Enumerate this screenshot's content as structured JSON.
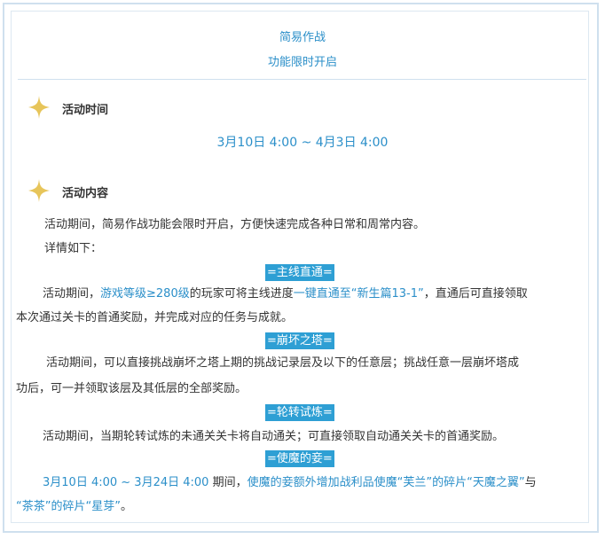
{
  "header": {
    "title": "简易作战",
    "subtitle": "功能限时开启"
  },
  "colors": {
    "accent": "#2b8fc9",
    "tag_bg": "#2e9fd4",
    "star": "#e7c55a",
    "border": "#cfe0ee"
  },
  "section_time": {
    "icon": "star-icon",
    "title": "活动时间",
    "time": "3月10日 4:00 ~ 4月3日 4:00"
  },
  "section_content": {
    "icon": "star-icon",
    "title": "活动内容",
    "intro": "活动期间，简易作战功能会限时开启，方便快速完成各种日常和周常内容。",
    "detail": "详情如下："
  },
  "mainline": {
    "tag": "=主线直通=",
    "p_a": "活动期间，",
    "p_b": "游戏等级≥280级",
    "p_c": "的玩家可将主线进度",
    "p_d": "一键直通至“新生篇13-1”",
    "p_e": "，直通后可直接领取",
    "p_line2": "本次通过关卡的首通奖励，并完成对应的任务与成就。"
  },
  "tower": {
    "tag": "=崩坏之塔=",
    "p_line1": "活动期间，可以直接挑战崩坏之塔上期的挑战记录层及以下的任意层；挑战任意一层崩坏塔成",
    "p_line2": "功后，可一并领取该层及其低层的全部奖励。"
  },
  "trial": {
    "tag": "=轮转试炼=",
    "p_line1": "活动期间，当期轮转试炼的未通关关卡将自动通关；可直接领取自动通关关卡的首通奖励。"
  },
  "emissary": {
    "tag": "=使魔的妾=",
    "p_a": "3月10日 4:00 ~ 3月24日 4:00",
    "p_b": "期间，",
    "p_c": "使魔的妾额外增加战利品使魔",
    "p_d": "“芙兰”的碎片“天魔之翼”",
    "p_e": "与",
    "p_f": "“茶茶”的碎片“星芽”",
    "p_g": "。"
  }
}
